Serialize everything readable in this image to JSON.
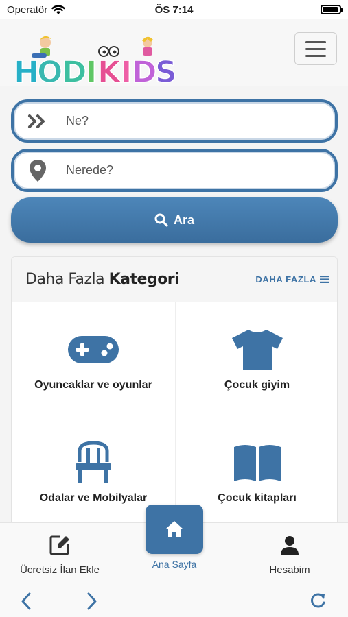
{
  "status": {
    "carrier": "Operatör",
    "time": "ÖS 7:14"
  },
  "header": {
    "logo_text": "HODIKIDS",
    "menu_icon": "hamburger-icon"
  },
  "search": {
    "what_placeholder": "Ne?",
    "where_placeholder": "Nerede?",
    "button_label": "Ara",
    "what_icon": "double-chevron-right-icon",
    "where_icon": "map-marker-icon",
    "button_icon": "search-icon"
  },
  "categories": {
    "title_light": "Daha Fazla",
    "title_bold": "Kategori",
    "more_label": "DAHA FAZLA",
    "items": [
      {
        "label": "Oyuncaklar ve oyunlar",
        "icon": "gamepad-icon"
      },
      {
        "label": "Çocuk giyim",
        "icon": "tshirt-icon"
      },
      {
        "label": "Odalar ve Mobilyalar",
        "icon": "chair-icon"
      },
      {
        "label": "Çocuk kitapları",
        "icon": "book-open-icon"
      }
    ]
  },
  "bottom_nav": {
    "add_label": "Ücretsiz İlan Ekle",
    "home_label": "Ana Sayfa",
    "account_label": "Hesabim"
  },
  "colors": {
    "accent": "#3e73a5",
    "background": "#f4f4f4"
  }
}
